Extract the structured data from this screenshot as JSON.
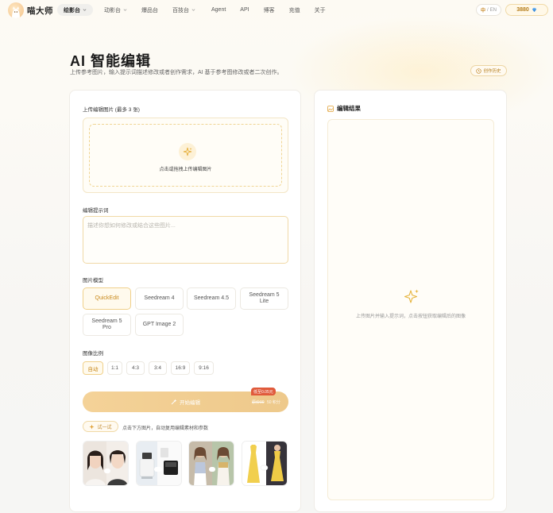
{
  "brand": {
    "name": "喵大师"
  },
  "nav": {
    "items": [
      {
        "label": "绘影台",
        "dropdown": true,
        "active": true
      },
      {
        "label": "动影台",
        "dropdown": true,
        "active": false
      },
      {
        "label": "爆品台",
        "dropdown": false,
        "active": false
      },
      {
        "label": "百技台",
        "dropdown": true,
        "active": false
      },
      {
        "label": "Agent",
        "dropdown": false,
        "active": false
      },
      {
        "label": "API",
        "dropdown": false,
        "active": false
      },
      {
        "label": "博客",
        "dropdown": false,
        "active": false
      },
      {
        "label": "充值",
        "dropdown": false,
        "active": false
      },
      {
        "label": "关于",
        "dropdown": false,
        "active": false
      }
    ],
    "lang_current": "中",
    "lang_sep": "/",
    "lang_other": "EN",
    "coins": "3880"
  },
  "hero": {
    "title": "AI 智能编辑",
    "subtitle": "上传参考图片，输入提示词描述修改或者创作需求，AI 基于参考图修改或者二次创作。",
    "history_label": "创作历史"
  },
  "editor": {
    "upload_label": "上传编辑图片 (最多 3 张)",
    "upload_hint": "点击或拖拽上传编辑图片",
    "prompt_label": "编辑提示词",
    "prompt_placeholder": "描述你想如何修改或结合这些图片...",
    "model_label": "图片模型",
    "models": [
      {
        "label": "QuickEdit",
        "selected": true
      },
      {
        "label": "Seedream 4",
        "selected": false
      },
      {
        "label": "Seedream 4.5",
        "selected": false
      },
      {
        "label": "Seedream 5 Lite",
        "selected": false
      },
      {
        "label": "Seedream 5 Pro",
        "selected": false
      },
      {
        "label": "GPT Image 2",
        "selected": false
      }
    ],
    "ratio_label": "图像比例",
    "ratios": [
      {
        "label": "自动",
        "selected": true
      },
      {
        "label": "1:1",
        "selected": false
      },
      {
        "label": "4:3",
        "selected": false
      },
      {
        "label": "3:4",
        "selected": false
      },
      {
        "label": "16:9",
        "selected": false
      },
      {
        "label": "9:16",
        "selected": false
      }
    ],
    "generate_label": "开始编辑",
    "cost_original": "原价90",
    "cost_current": "50 积分",
    "discount_badge": "低至0.05元",
    "try_label": "试一试",
    "try_hint": "点击下方图片，自动复用编辑素材和参数"
  },
  "result": {
    "title": "编辑结果",
    "empty_hint": "上传图片并输入提示词，点击按钮获取编辑后的图像"
  },
  "colors": {
    "accent": "#c98a1d",
    "accent_light": "#fffaed",
    "button": "#f0cd90",
    "discount": "#e05a3b"
  }
}
